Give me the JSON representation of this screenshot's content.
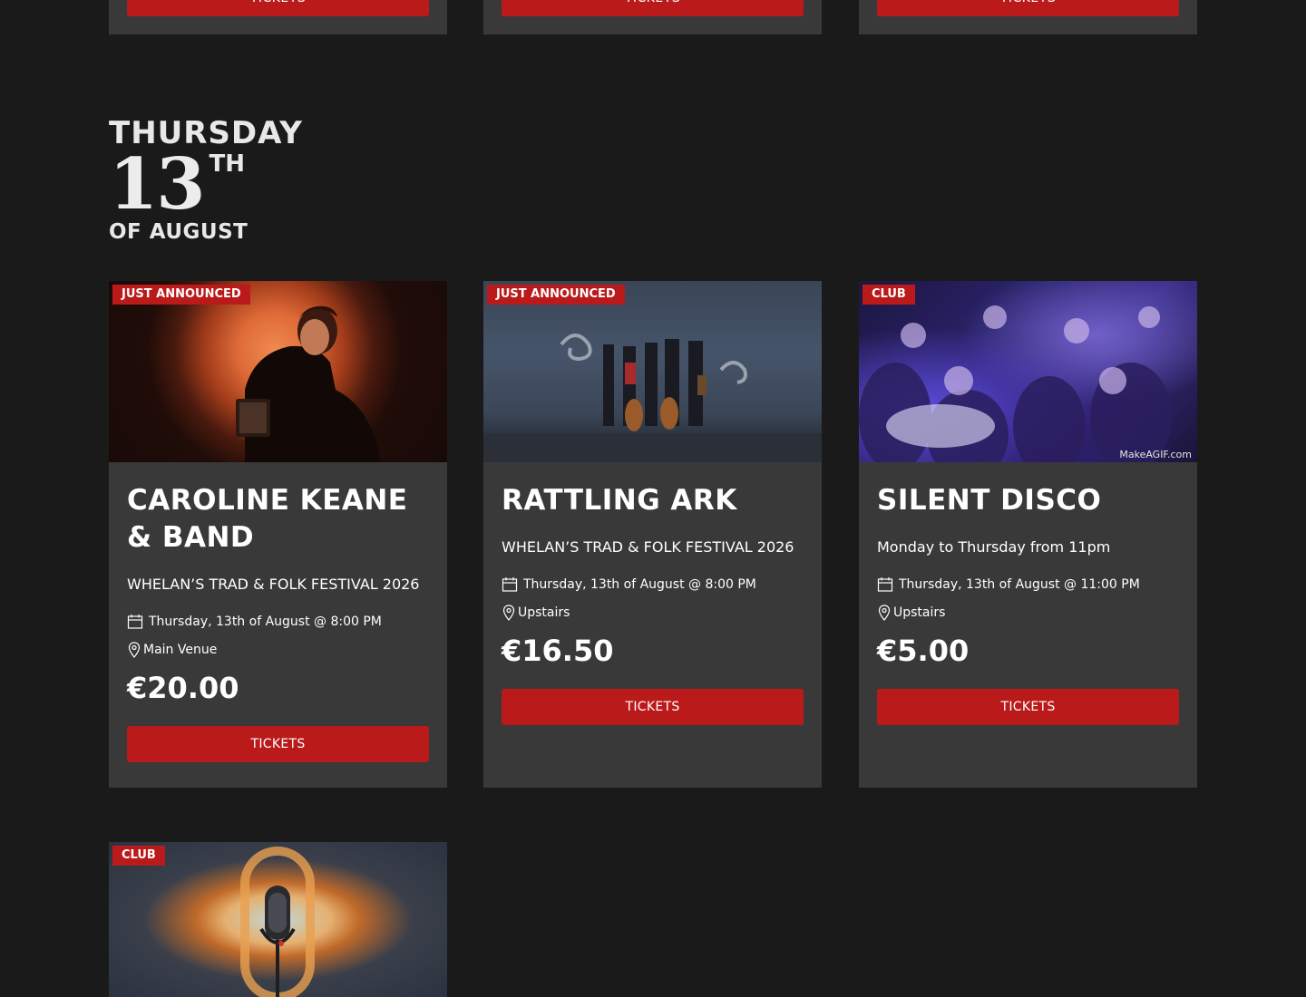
{
  "previous_row": {
    "cards": [
      {
        "button_label": "TICKETS"
      },
      {
        "button_label": "TICKETS"
      },
      {
        "button_label": "TICKETS"
      }
    ]
  },
  "date_header": {
    "day_of_week": "THURSDAY",
    "day_number": "13",
    "day_suffix": "TH",
    "month": "OF AUGUST"
  },
  "events": [
    {
      "badge": "JUST ANNOUNCED",
      "title": "CAROLINE KEANE & BAND",
      "subtitle": "WHELAN’S TRAD & FOLK FESTIVAL 2026",
      "datetime": "Thursday, 13th of August @ 8:00 PM",
      "venue": "Main Venue",
      "price": "€20.00",
      "button_label": "TICKETS"
    },
    {
      "badge": "JUST ANNOUNCED",
      "title": "RATTLING ARK",
      "subtitle": "WHELAN’S TRAD & FOLK FESTIVAL 2026",
      "datetime": "Thursday, 13th of August @ 8:00 PM",
      "venue": "Upstairs",
      "price": "€16.50",
      "button_label": "TICKETS"
    },
    {
      "badge": "CLUB",
      "title": "SILENT DISCO",
      "subtitle": "Monday to Thursday from 11pm",
      "datetime": "Thursday, 13th of August @ 11:00 PM",
      "venue": "Upstairs",
      "price": "€5.00",
      "button_label": "TICKETS",
      "image_watermark": "MakeAGIF.com"
    },
    {
      "badge": "CLUB"
    }
  ],
  "colors": {
    "background": "#1b1a1b",
    "card": "#3a393a",
    "accent": "#bb1a1a",
    "text": "#ffffff"
  },
  "icons": {
    "datetime": "calendar-icon",
    "venue": "map-pin-icon"
  }
}
